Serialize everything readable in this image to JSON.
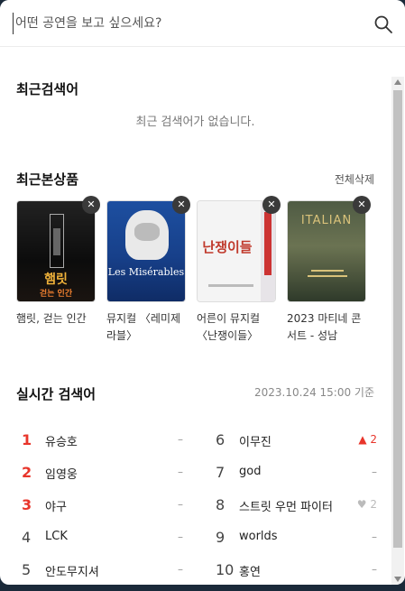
{
  "search": {
    "placeholder": "어떤 공연을 보고 싶으세요?"
  },
  "recent_searches": {
    "title": "최근검색어",
    "empty_message": "최근 검색어가 없습니다."
  },
  "recent_viewed": {
    "title": "최근본상품",
    "clear_all": "전체삭제",
    "remove_label": "✕",
    "items": [
      {
        "title": "햄릿, 걷는 인간",
        "poster_text": "햄릿",
        "poster_sub": "걷는 인간"
      },
      {
        "title": "뮤지컬 〈레미제라블〉",
        "poster_text": "Les Misérables",
        "poster_sub": ""
      },
      {
        "title": "어른이 뮤지컬 〈난쟁이들〉",
        "poster_text": "난쟁이들",
        "poster_sub": ""
      },
      {
        "title": "2023 마티네 콘서트 - 성남",
        "poster_text": "ITALIAN",
        "poster_sub": ""
      }
    ]
  },
  "realtime": {
    "title": "실시간 검색어",
    "timestamp": "2023.10.24 15:00 기준",
    "left": [
      {
        "rank": "1",
        "keyword": "유승호",
        "change": "–",
        "trend": "same"
      },
      {
        "rank": "2",
        "keyword": "임영웅",
        "change": "–",
        "trend": "same"
      },
      {
        "rank": "3",
        "keyword": "야구",
        "change": "–",
        "trend": "same"
      },
      {
        "rank": "4",
        "keyword": "LCK",
        "change": "–",
        "trend": "same"
      },
      {
        "rank": "5",
        "keyword": "안도무지셔",
        "change": "–",
        "trend": "same"
      }
    ],
    "right": [
      {
        "rank": "6",
        "keyword": "이무진",
        "change": "▲ 2",
        "trend": "up"
      },
      {
        "rank": "7",
        "keyword": "god",
        "change": "–",
        "trend": "same"
      },
      {
        "rank": "8",
        "keyword": "스트릿 우먼 파이터",
        "change": "♥ 2",
        "trend": "down"
      },
      {
        "rank": "9",
        "keyword": "worlds",
        "change": "–",
        "trend": "same"
      },
      {
        "rank": "10",
        "keyword": "홍연",
        "change": "–",
        "trend": "same"
      }
    ]
  }
}
